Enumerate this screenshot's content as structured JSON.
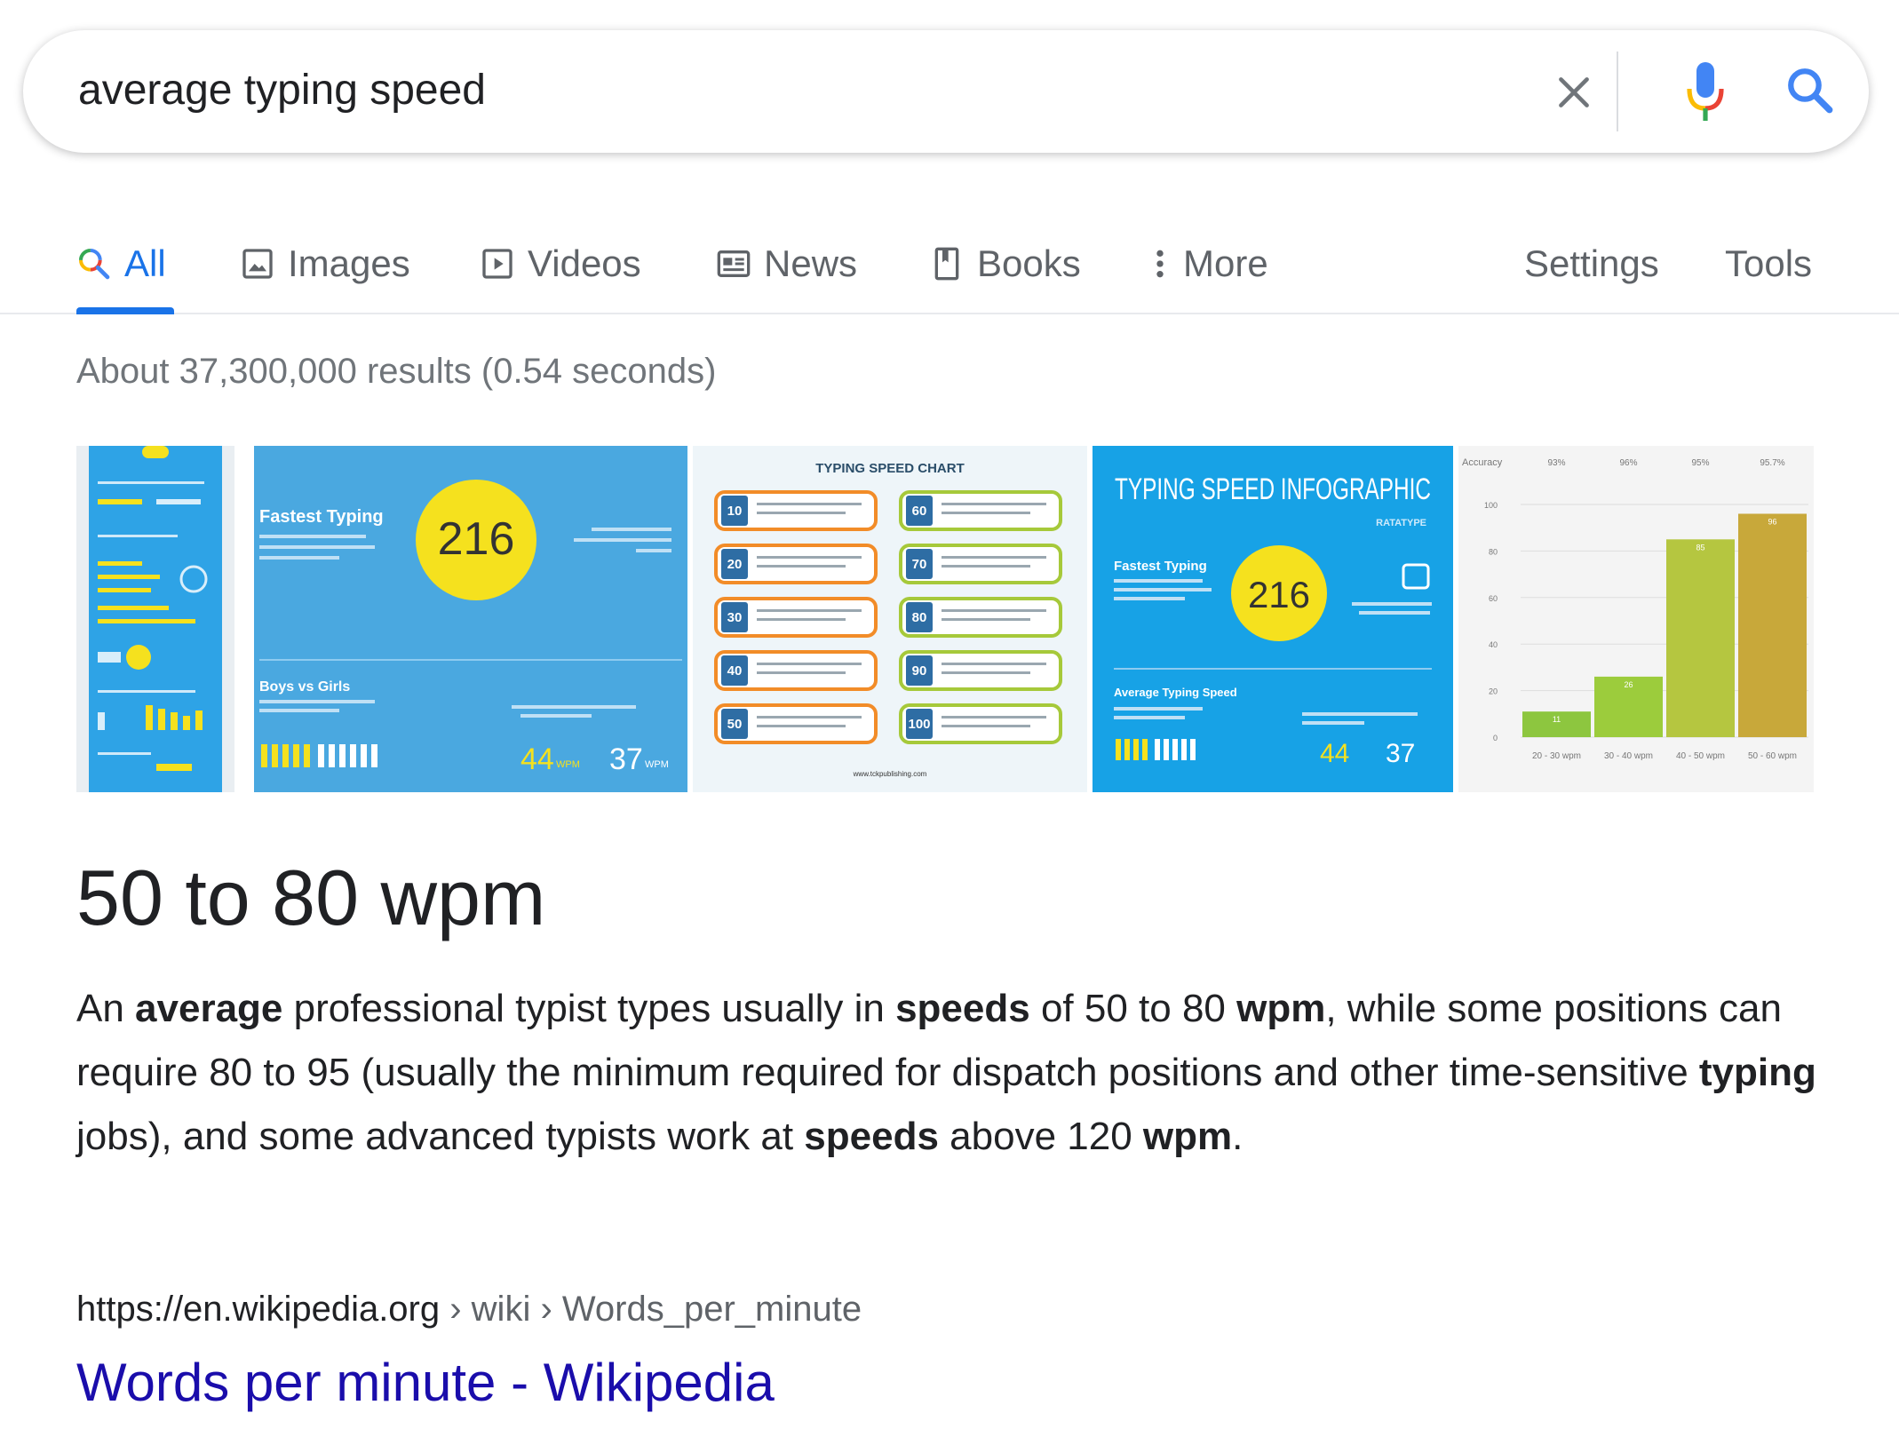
{
  "search": {
    "query": "average typing speed",
    "icons": {
      "clear": "close-icon",
      "mic": "microphone-icon",
      "search": "search-icon"
    }
  },
  "tabs": [
    {
      "label": "All",
      "icon": "search-icon",
      "active": true
    },
    {
      "label": "Images",
      "icon": "image-icon"
    },
    {
      "label": "Videos",
      "icon": "play-icon"
    },
    {
      "label": "News",
      "icon": "newspaper-icon"
    },
    {
      "label": "Books",
      "icon": "book-icon"
    },
    {
      "label": "More",
      "icon": "more-vertical-icon"
    }
  ],
  "tools": {
    "settings": "Settings",
    "tools": "Tools"
  },
  "result_stats": "About 37,300,000 results (0.54 seconds)",
  "images": {
    "thumb2": {
      "heading": "Fastest Typing",
      "big_number": "216",
      "section": "Boys vs Girls",
      "stat_a": "44",
      "stat_b": "37",
      "unit": "WPM"
    },
    "thumb3": {
      "title": "TYPING SPEED CHART",
      "levels_left": [
        "10",
        "20",
        "30",
        "40",
        "50"
      ],
      "levels_right": [
        "60",
        "70",
        "80",
        "90",
        "100"
      ],
      "footer": "www.tckpublishing.com"
    },
    "thumb4": {
      "title": "TYPING SPEED INFOGRAPHIC",
      "brand": "RATATYPE",
      "heading": "Fastest Typing",
      "big_number": "216",
      "section": "Average Typing Speed",
      "stat_a": "44",
      "stat_b": "37"
    },
    "thumb5": {
      "accuracy_label": "Accuracy",
      "accuracy": [
        "93%",
        "96%",
        "95%",
        "95.7%"
      ],
      "bars": [
        11,
        26,
        85,
        96
      ],
      "yticks": [
        "100",
        "80",
        "60",
        "40",
        "20",
        "0"
      ],
      "categories": [
        "20 - 30 wpm",
        "30 - 40 wpm",
        "40 - 50 wpm",
        "50 - 60 wpm"
      ],
      "colors": [
        "#8dc63f",
        "#9ccc3c",
        "#b5c640",
        "#c8a83a"
      ]
    }
  },
  "answer": {
    "title": "50 to 80 wpm",
    "snippet": [
      {
        "t": "An ",
        "b": false
      },
      {
        "t": "average",
        "b": true
      },
      {
        "t": " professional typist types usually in ",
        "b": false
      },
      {
        "t": "speeds",
        "b": true
      },
      {
        "t": " of 50 to 80 ",
        "b": false
      },
      {
        "t": "wpm",
        "b": true
      },
      {
        "t": ", while some positions can require 80 to 95 (usually the minimum required for dispatch positions and other time-sensitive ",
        "b": false
      },
      {
        "t": "typing",
        "b": true
      },
      {
        "t": " jobs), and some advanced typists work at ",
        "b": false
      },
      {
        "t": "speeds",
        "b": true
      },
      {
        "t": " above 120 ",
        "b": false
      },
      {
        "t": "wpm",
        "b": true
      },
      {
        "t": ".",
        "b": false
      }
    ]
  },
  "source": {
    "domain": "https://en.wikipedia.org",
    "breadcrumbs": " › wiki › Words_per_minute",
    "title": "Words per minute - Wikipedia"
  },
  "colors": {
    "accent": "#1a73e8",
    "link": "#1a0dab",
    "thumb_blue": "#4aa8e0",
    "thumb_yellow": "#f5e11e"
  }
}
